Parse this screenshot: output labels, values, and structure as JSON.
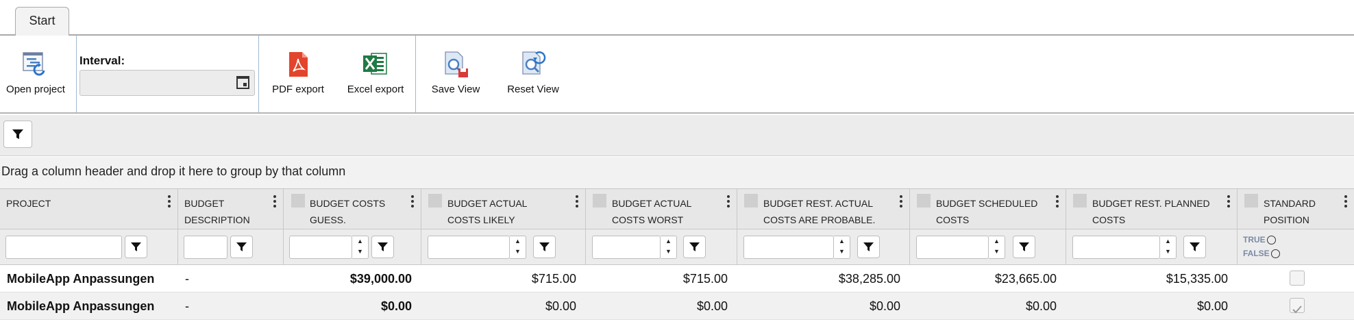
{
  "tabs": [
    {
      "label": "Start"
    }
  ],
  "ribbon": {
    "open_project": "Open project",
    "interval_label": "Interval:",
    "interval_value": "",
    "pdf_export": "PDF export",
    "excel_export": "Excel export",
    "save_view": "Save View",
    "reset_view": "Reset View"
  },
  "group_hint": "Drag a column header and drop it here to group by that column",
  "columns": [
    {
      "line1": "PROJECT",
      "line2": ""
    },
    {
      "line1": "BUDGET",
      "line2": "DESCRIPTION"
    },
    {
      "line1": "BUDGET COSTS",
      "line2": "GUESS."
    },
    {
      "line1": "BUDGET ACTUAL",
      "line2": "COSTS LIKELY"
    },
    {
      "line1": "BUDGET ACTUAL",
      "line2": "COSTS WORST"
    },
    {
      "line1": "BUDGET REST. ACTUAL",
      "line2": "COSTS ARE PROBABLE."
    },
    {
      "line1": "BUDGET SCHEDULED",
      "line2": "COSTS"
    },
    {
      "line1": "BUDGET REST. PLANNED",
      "line2": "COSTS"
    },
    {
      "line1": "STANDARD",
      "line2": "POSITION"
    }
  ],
  "bool_filter": {
    "true_label": "TRUE",
    "false_label": "FALSE"
  },
  "rows": [
    {
      "project": "MobileApp Anpassungen",
      "description": "-",
      "guess": "$39,000.00",
      "likely": "$715.00",
      "worst": "$715.00",
      "probable": "$38,285.00",
      "scheduled": "$23,665.00",
      "planned": "$15,335.00",
      "standard": false
    },
    {
      "project": "MobileApp Anpassungen",
      "description": "-",
      "guess": "$0.00",
      "likely": "$0.00",
      "worst": "$0.00",
      "probable": "$0.00",
      "scheduled": "$0.00",
      "planned": "$0.00",
      "standard": true
    }
  ],
  "colors": {
    "accent_blue": "#4a7fc1",
    "pdf_red": "#e2452c",
    "excel_green": "#1f7a44"
  }
}
